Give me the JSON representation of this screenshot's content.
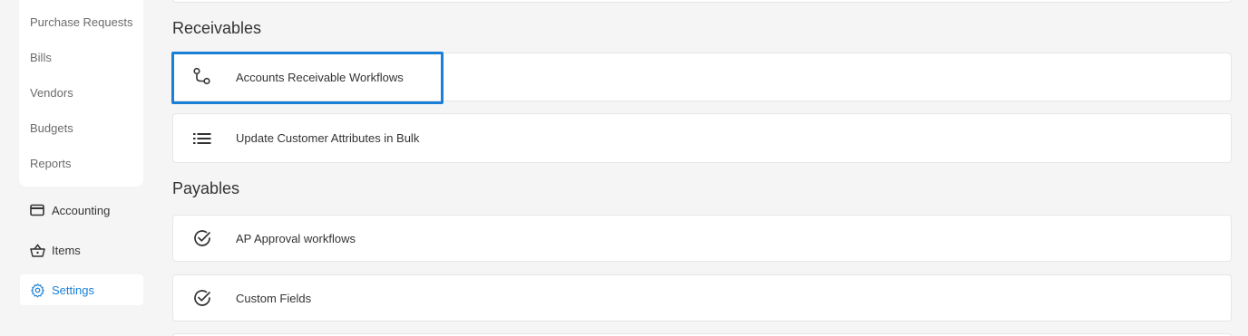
{
  "sidebar": {
    "sub_items": [
      {
        "label": "Purchase Requests"
      },
      {
        "label": "Bills"
      },
      {
        "label": "Vendors"
      },
      {
        "label": "Budgets"
      },
      {
        "label": "Reports"
      }
    ],
    "nav": [
      {
        "label": "Accounting",
        "icon": "credit-card-icon"
      },
      {
        "label": "Items",
        "icon": "basket-icon"
      },
      {
        "label": "Settings",
        "icon": "gear-icon",
        "active": true
      }
    ]
  },
  "sections": [
    {
      "title": "Receivables",
      "items": [
        {
          "label": "Accounts Receivable Workflows",
          "icon": "workflow-route-icon"
        },
        {
          "label": "Update Customer Attributes in Bulk",
          "icon": "list-icon"
        }
      ]
    },
    {
      "title": "Payables",
      "items": [
        {
          "label": "AP Approval workflows",
          "icon": "check-circle-icon"
        },
        {
          "label": "Custom Fields",
          "icon": "check-circle-icon"
        }
      ]
    }
  ],
  "colors": {
    "accent": "#1a7fd6",
    "background": "#f5f5f5"
  }
}
